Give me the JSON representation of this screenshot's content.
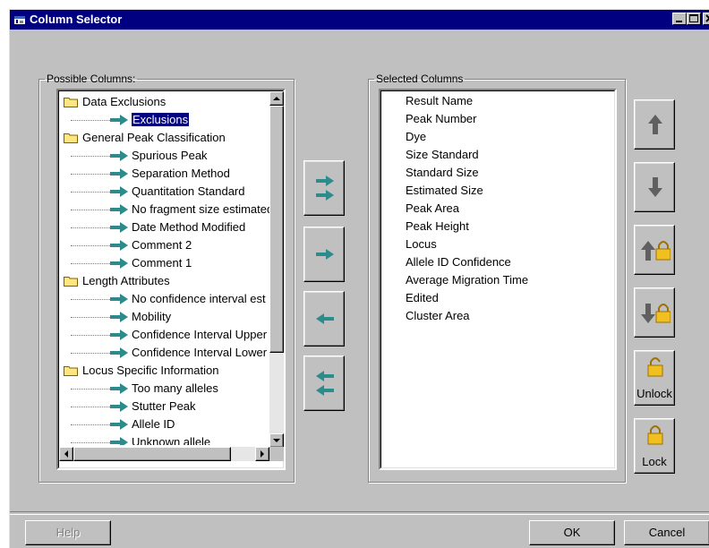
{
  "window": {
    "title": "Column Selector",
    "icon": "app-icon",
    "controls": [
      "minimize",
      "maximize",
      "close"
    ]
  },
  "possible": {
    "legend": "Possible Columns:",
    "tree": [
      {
        "category": "Data Exclusions",
        "items": [
          "Exclusions"
        ]
      },
      {
        "category": "General Peak Classification",
        "items": [
          "Spurious Peak",
          "Separation Method",
          "Quantitation Standard",
          "No fragment size estimated",
          "Date Method Modified",
          "Comment 2",
          "Comment 1"
        ]
      },
      {
        "category": "Length Attributes",
        "items": [
          "No confidence interval est",
          "Mobility",
          "Confidence Interval Upper",
          "Confidence Interval Lower"
        ]
      },
      {
        "category": "Locus Specific Information",
        "items": [
          "Too many alleles",
          "Stutter Peak",
          "Allele ID",
          "Unknown allele"
        ]
      }
    ],
    "selected_item": "Exclusions"
  },
  "transfer_buttons": [
    {
      "name": "add-all-button",
      "icon": "double-right-arrow-icon"
    },
    {
      "name": "add-button",
      "icon": "right-arrow-icon"
    },
    {
      "name": "remove-button",
      "icon": "left-arrow-icon"
    },
    {
      "name": "remove-all-button",
      "icon": "double-left-arrow-icon"
    }
  ],
  "selected": {
    "legend": "Selected Columns",
    "items": [
      "Result Name",
      "Peak Number",
      "Dye",
      "Size Standard",
      "Standard Size",
      "Estimated Size",
      "Peak Area",
      "Peak Height",
      "Locus",
      "Allele ID Confidence",
      "Average Migration Time",
      "Edited",
      "Cluster Area"
    ]
  },
  "order_buttons": {
    "unlock_label": "Unlock",
    "lock_label": "Lock"
  },
  "footer": {
    "help_label": "Help",
    "ok_label": "OK",
    "cancel_label": "Cancel"
  },
  "colors": {
    "title_bar": "#000080",
    "arrow": "#2e8b8b",
    "lock": "#f0c020",
    "dialog": "#c0c0c0"
  }
}
